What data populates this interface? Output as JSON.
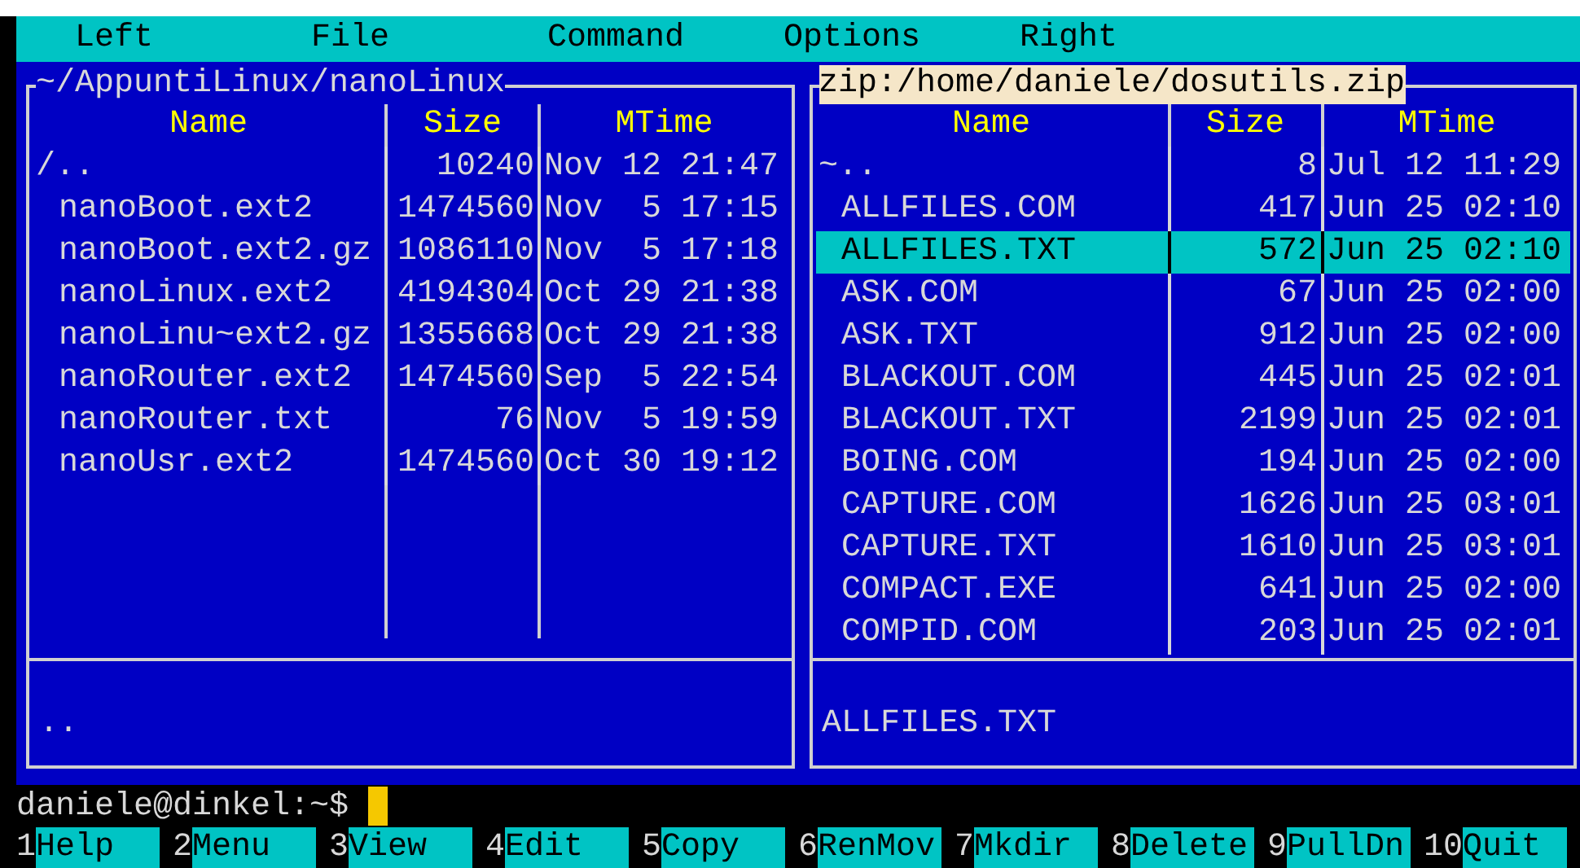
{
  "menu_bar": [
    {
      "label": "Left"
    },
    {
      "label": "File"
    },
    {
      "label": "Command"
    },
    {
      "label": "Options"
    },
    {
      "label": "Right"
    }
  ],
  "panels": [
    {
      "path": "~/AppuntiLinux/nanoLinux",
      "active": false,
      "columns": [
        "Name",
        "Size",
        "MTime"
      ],
      "rows": [
        {
          "kind": "updir",
          "name": "/..",
          "size": "10240",
          "mtime": "Nov 12 21:47",
          "selected": false
        },
        {
          "kind": "file",
          "name": "nanoBoot.ext2",
          "size": "1474560",
          "mtime": "Nov  5 17:15",
          "selected": false
        },
        {
          "kind": "file",
          "name": "nanoBoot.ext2.gz",
          "size": "1086110",
          "mtime": "Nov  5 17:18",
          "selected": false
        },
        {
          "kind": "file",
          "name": "nanoLinux.ext2",
          "size": "4194304",
          "mtime": "Oct 29 21:38",
          "selected": false
        },
        {
          "kind": "file",
          "name": "nanoLinu~ext2.gz",
          "size": "1355668",
          "mtime": "Oct 29 21:38",
          "selected": false
        },
        {
          "kind": "file",
          "name": "nanoRouter.ext2",
          "size": "1474560",
          "mtime": "Sep  5 22:54",
          "selected": false
        },
        {
          "kind": "file",
          "name": "nanoRouter.txt",
          "size": "76",
          "mtime": "Nov  5 19:59",
          "selected": false
        },
        {
          "kind": "file",
          "name": "nanoUsr.ext2",
          "size": "1474560",
          "mtime": "Oct 30 19:12",
          "selected": false
        }
      ],
      "mini_status": ".."
    },
    {
      "path": "zip:/home/daniele/dosutils.zip",
      "active": true,
      "columns": [
        "Name",
        "Size",
        "MTime"
      ],
      "rows": [
        {
          "kind": "updir",
          "name": "~..",
          "size": "8",
          "mtime": "Jul 12 11:29",
          "selected": false
        },
        {
          "kind": "file",
          "name": "ALLFILES.COM",
          "size": "417",
          "mtime": "Jun 25 02:10",
          "selected": false
        },
        {
          "kind": "file",
          "name": "ALLFILES.TXT",
          "size": "572",
          "mtime": "Jun 25 02:10",
          "selected": true
        },
        {
          "kind": "file",
          "name": "ASK.COM",
          "size": "67",
          "mtime": "Jun 25 02:00",
          "selected": false
        },
        {
          "kind": "file",
          "name": "ASK.TXT",
          "size": "912",
          "mtime": "Jun 25 02:00",
          "selected": false
        },
        {
          "kind": "file",
          "name": "BLACKOUT.COM",
          "size": "445",
          "mtime": "Jun 25 02:01",
          "selected": false
        },
        {
          "kind": "file",
          "name": "BLACKOUT.TXT",
          "size": "2199",
          "mtime": "Jun 25 02:01",
          "selected": false
        },
        {
          "kind": "file",
          "name": "BOING.COM",
          "size": "194",
          "mtime": "Jun 25 02:00",
          "selected": false
        },
        {
          "kind": "file",
          "name": "CAPTURE.COM",
          "size": "1626",
          "mtime": "Jun 25 03:01",
          "selected": false
        },
        {
          "kind": "file",
          "name": "CAPTURE.TXT",
          "size": "1610",
          "mtime": "Jun 25 03:01",
          "selected": false
        },
        {
          "kind": "file",
          "name": "COMPACT.EXE",
          "size": "641",
          "mtime": "Jun 25 02:00",
          "selected": false
        },
        {
          "kind": "file",
          "name": "COMPID.COM",
          "size": "203",
          "mtime": "Jun 25 02:01",
          "selected": false
        }
      ],
      "mini_status": "ALLFILES.TXT"
    }
  ],
  "command_line": {
    "prompt": "daniele@dinkel:~$"
  },
  "function_keys": [
    {
      "number": "1",
      "label": "Help"
    },
    {
      "number": "2",
      "label": "Menu"
    },
    {
      "number": "3",
      "label": "View"
    },
    {
      "number": "4",
      "label": "Edit"
    },
    {
      "number": "5",
      "label": "Copy"
    },
    {
      "number": "6",
      "label": "RenMov"
    },
    {
      "number": "7",
      "label": "Mkdir"
    },
    {
      "number": "8",
      "label": "Delete"
    },
    {
      "number": "9",
      "label": "PullDn"
    },
    {
      "number": "10",
      "label": "Quit"
    }
  ]
}
